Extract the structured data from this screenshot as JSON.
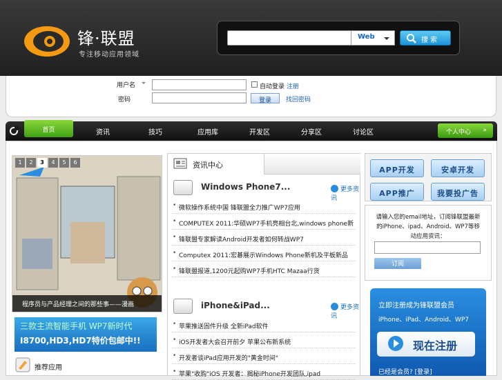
{
  "logo": {
    "title": "锋·联盟",
    "slogan": "专注移动应用领域"
  },
  "search": {
    "scope": "Web",
    "button": "搜 索",
    "value": ""
  },
  "login": {
    "user_label": "用户名",
    "pass_label": "密码",
    "remember_label": "自动登录",
    "register_link": "注册",
    "forgot_link": "找回密码",
    "login_button": "登录"
  },
  "nav": {
    "items": [
      "首页",
      "资讯",
      "技巧",
      "应用库",
      "开发区",
      "分享区",
      "讨论区"
    ],
    "user_center": "个人中心"
  },
  "slider": {
    "pages": [
      "1",
      "2",
      "3",
      "4",
      "5",
      "6"
    ],
    "active_page": "3",
    "caption": "程序员与产品经理之间的那些事——漫画"
  },
  "banner": {
    "line1": "三款主流智能手机 WP7新时代",
    "line2": "I8700,HD3,HD7特价包邮中!!"
  },
  "left_bottom": {
    "title": "推荐应用"
  },
  "mid": {
    "tab": "资讯中心",
    "sections": [
      {
        "title": "Windows Phone7...",
        "more": "更多资讯",
        "items": [
          "微软操作系统中国 锋联盟全力推广WP7应用",
          "COMPUTEX 2011:华硕WP7手机亮相台北,windows phone新",
          "锋联盟专家解读Android开发者如何转战WP7",
          "Computex 2011:宏碁展示Windows Phone新机及平板新品",
          "锋联盟报道,1200元起购WP7手机HTC Mazaa行货"
        ]
      },
      {
        "title": "iPhone&iPad...",
        "more": "更多资讯",
        "items": [
          "苹果推送固件升级 全新iPad软件",
          "iOS开发者大会召开前夕 苹果公布新系统",
          "开发者谈iPad应用开发的\"黄金时间\"",
          "苹果\"收购\"iOS 开发者：揭秘iPhone开发团队,ipad"
        ]
      }
    ]
  },
  "right": {
    "buttons": [
      "APP开发",
      "安卓开发",
      "APP推广",
      "我要投广告"
    ],
    "subscribe_text": "请输入您的email地址，订阅锋联盟最新的iPhone、ipad、Android、WP7等移动应用资讯：",
    "subscribe_button": "订阅",
    "reg_title": "立即注册成为锋联盟会员",
    "reg_sub": "iPhone、iPad、Android、WP7",
    "reg_button": "现在注册",
    "reg_footer": "已经是会员? [登录]"
  }
}
